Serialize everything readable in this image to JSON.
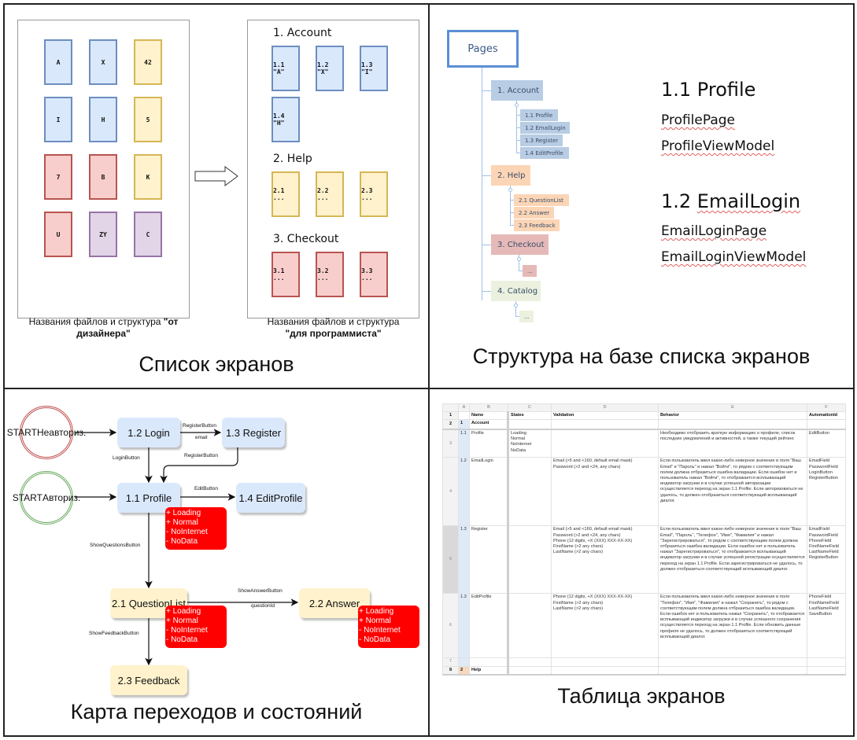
{
  "q1": {
    "caption": "Список экранов",
    "designer_cards": [
      {
        "label": "A",
        "color": "blue"
      },
      {
        "label": "X",
        "color": "blue"
      },
      {
        "label": "42",
        "color": "yellow"
      },
      {
        "label": "I",
        "color": "blue"
      },
      {
        "label": "H",
        "color": "blue"
      },
      {
        "label": "5",
        "color": "yellow"
      },
      {
        "label": "7",
        "color": "red"
      },
      {
        "label": "B",
        "color": "red"
      },
      {
        "label": "K",
        "color": "yellow"
      },
      {
        "label": "U",
        "color": "red"
      },
      {
        "label": "ZY",
        "color": "purple"
      },
      {
        "label": "C",
        "color": "purple"
      }
    ],
    "sections": [
      {
        "title": "1. Account",
        "cards": [
          "1.1 \"A\"",
          "1.2 \"X\"",
          "1.3 \"I\"",
          "1.4 \"H\""
        ]
      },
      {
        "title": "2. Help",
        "cards": [
          "2.1 ...",
          "2.2 ...",
          "2.3 ..."
        ]
      },
      {
        "title": "3. Checkout",
        "cards": [
          "3.1 ...",
          "3.2 ...",
          "3.3 ..."
        ]
      }
    ],
    "left_caption_plain": "Названия файлов и структура ",
    "left_caption_bold": "\"от дизайнера\"",
    "right_caption_plain": "Названия файлов и структура",
    "right_caption_bold": "\"для программиста\""
  },
  "q2": {
    "caption": "Структура на базе списка экранов",
    "root": "Pages",
    "groups": [
      {
        "label": "1. Account",
        "color": "#b8cce4",
        "children": [
          "1.1 Profile",
          "1.2 EmailLogin",
          "1.3 Register",
          "1.4 EditProfile"
        ]
      },
      {
        "label": "2. Help",
        "color": "#fbd5b5",
        "children": [
          "2.1 QuestionList",
          "2.2 Answer",
          "2.3 Feedback"
        ]
      },
      {
        "label": "3. Checkout",
        "color": "#e5b9b7",
        "children": [
          "..."
        ]
      },
      {
        "label": "4. Catalog",
        "color": "#ebf1de",
        "children": [
          "..."
        ]
      }
    ],
    "examples": [
      {
        "title": "1.1 Profile",
        "page": "ProfilePage",
        "viewmodel": "ProfileViewModel"
      },
      {
        "title": "1.2 EmailLogin",
        "page": "EmailLoginPage",
        "viewmodel": "EmailLoginViewModel"
      }
    ]
  },
  "q3": {
    "caption": "Карта переходов и состояний",
    "start_unauth": "START Неавториз.",
    "start_auth": "START Авториз.",
    "nodes": {
      "login": "1.2 Login",
      "register": "1.3 Register",
      "profile": "1.1 Profile",
      "edit_profile": "1.4 EditProfile",
      "question_list": "2.1 QuestionList",
      "answer": "2.2 Answer",
      "feedback": "2.3 Feedback"
    },
    "edges": {
      "login_to_register": "RegisterButton",
      "login_to_register_param": "email",
      "login_to_profile": "LoginButton",
      "register_to_profile": "RegisterButton",
      "profile_to_edit": "EditButton",
      "profile_to_questions": "ShowQuestionsButton",
      "questions_to_answer": "ShowAnswerButton",
      "questions_to_answer_param": "questionId",
      "questions_to_feedback": "ShowFeedbackButton"
    },
    "states": [
      "+ Loading",
      "+ Normal",
      "- NoInternet",
      "- NoData"
    ],
    "state_color": "#ff0000"
  },
  "q4": {
    "caption": "Таблица экранов",
    "columns": [
      "",
      "A",
      "B",
      "C",
      "D",
      "E",
      "F"
    ],
    "header": {
      "name": "Name",
      "states": "States",
      "validation": "Validation",
      "behavior": "Behavior",
      "automation": "AutomationId"
    },
    "rows": [
      {
        "n": "2",
        "a": "1",
        "b": "Account",
        "c": "",
        "d": "",
        "e": "",
        "f": ""
      },
      {
        "n": "3",
        "a": "1.1",
        "b": "Profile",
        "c": "Loading\nNormal\nNoInternet\nNoData",
        "d": "",
        "e": "Необходимо отобразить краткую информацию о профиле, список последних уведомлений и активностей, а также текущий рейтинг.",
        "f": "EditButton"
      },
      {
        "n": "4",
        "a": "1.2",
        "b": "EmailLogin",
        "c": "",
        "d": "Email (>5 and <160, default email mask)\nPassword (>2 and <24, any chars)",
        "e": "Если пользователь ввел какое-либо неверное значение в поля \"Ваш Email\" и \"Пароль\" и нажал \"Войти\", то рядом с соответствующим полем должна отбразиться ошибка валидации. Если ошибок нет и пользователь нажал \"Войти\", то отображается всплывающий индикатор загрузки и в случае успешной авторизации осуществляется переход на экран 1.1 Profile. Если авторизоваться не удалось, то должен отобразиться соответствующий всплывающий диалог.",
        "f": "EmailField\nPasswordField\nLoginButton\nRegisterButton"
      },
      {
        "n": "5",
        "a": "1.3",
        "b": "Register",
        "c": "",
        "d": "Email (>5 and <160, default email mask)\nPassword (>2 and <24, any chars)\nPhone (12 digits, +X (XXX) XXX-XX-XX)\nFirstName (>2 any chars)\nLastName (>2 any chars)",
        "e": "Если пользователь ввел какое-либо неверное значение в поля \"Ваш Email\", \"Пароль\", \"Телефон\", \"Имя\", \"Фамилия\" и нажал \"Зарегистрироваться\", то рядом с соответствующим полем должна отбразиться ошибка валидации. Если ошибок нет и пользователь нажал \"Зарегистрироваться\", то отображается всплывающий индикатор загрузки и в случае успешной регистрации осуществляется переход на экран 1.1 Profile. Если зарегистрироваться не удалось, то должен отобразиться соответствующий всплывающий диалог.",
        "f": "EmailField\nPasswordField\nPhoneField\nFirstNameField\nLastNameField\nRegisterButton"
      },
      {
        "n": "6",
        "a": "1.3",
        "b": "EditProfile",
        "c": "",
        "d": "Phone (12 digits, +X (XXX) XXX-XX-XX)\nFirstName (>2 any chars)\nLastName (>2 any chars)",
        "e": "Если пользователь ввел какое-либо неверное значение в поля \"Телефон\", \"Имя\", \"Фамилия\" и нажал \"Сохранить\", то рядом с соответствующим полем должна отбразиться ошибка валидации. Если ошибок нет и пользователь нажал \"Сохранить\", то отображается всплывающий индикатор загрузки и в случае успешного сохранения осуществляется переход на экран 1.1 Profile. Если обновить данные профиля не удалось, то должен отобразиться соответствующий всплывающий диалог.",
        "f": "PhoneField\nFirstNameField\nLastNameField\nSaveButton"
      },
      {
        "n": "7",
        "a": "",
        "b": "",
        "c": "",
        "d": "",
        "e": "",
        "f": ""
      },
      {
        "n": "8",
        "a": "2",
        "b": "Help",
        "c": "",
        "d": "",
        "e": "",
        "f": ""
      }
    ]
  }
}
